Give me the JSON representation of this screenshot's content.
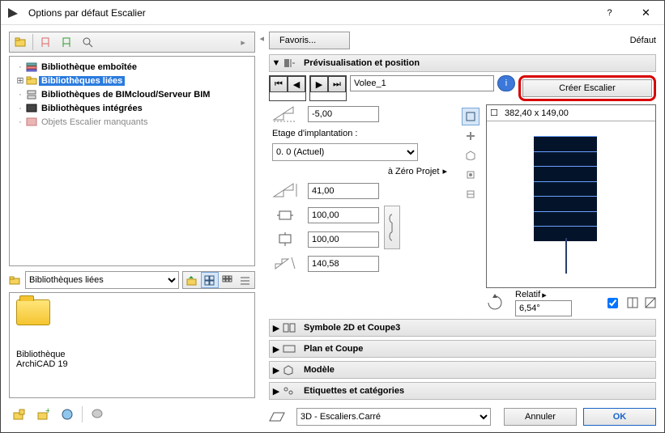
{
  "window": {
    "title": "Options par défaut Escalier",
    "help": "?",
    "close": "✕",
    "default_label": "Défaut"
  },
  "favorites": {
    "button": "Favoris..."
  },
  "tree": {
    "items": [
      {
        "label": "Bibliothèque emboîtée",
        "icon": "book-stack",
        "bold": true,
        "selected": false,
        "expander": "dot"
      },
      {
        "label": "Bibliothèques liées",
        "icon": "folder-yellow",
        "bold": true,
        "selected": true,
        "expander": "plus"
      },
      {
        "label": "Bibliothèques de BIMcloud/Serveur BIM",
        "icon": "server",
        "bold": true,
        "selected": false,
        "expander": "dot"
      },
      {
        "label": "Bibliothèques intégrées",
        "icon": "box-dark",
        "bold": true,
        "selected": false,
        "expander": "dot"
      },
      {
        "label": "Objets Escalier manquants",
        "icon": "box-red",
        "bold": false,
        "grey": true,
        "selected": false,
        "expander": "dot"
      }
    ]
  },
  "library_combo": {
    "value": "Bibliothèques liées"
  },
  "preview": {
    "name_line1": "Bibliothèque",
    "name_line2": "ArchiCAD 19"
  },
  "sections": {
    "preview_position": "Prévisualisation et position",
    "symbole": "Symbole 2D et Coupe3",
    "plan": "Plan et Coupe",
    "modele": "Modèle",
    "etiquettes": "Etiquettes et catégories"
  },
  "stair": {
    "name": "Volee_1",
    "create_button": "Créer Escalier",
    "elevation": "-5,00",
    "story_label": "Etage d'implantation :",
    "story_value": "0. 0 (Actuel)",
    "ref_label": "à Zéro Projet",
    "height_ref": "41,00",
    "width": "100,00",
    "depth": "100,00",
    "run": "140,58",
    "plan_size": "382,40 x 149,00",
    "relative_label": "Relatif",
    "relative_angle": "6,54°"
  },
  "footer": {
    "view_select": "3D - Escaliers.Carré",
    "cancel": "Annuler",
    "ok": "OK"
  }
}
